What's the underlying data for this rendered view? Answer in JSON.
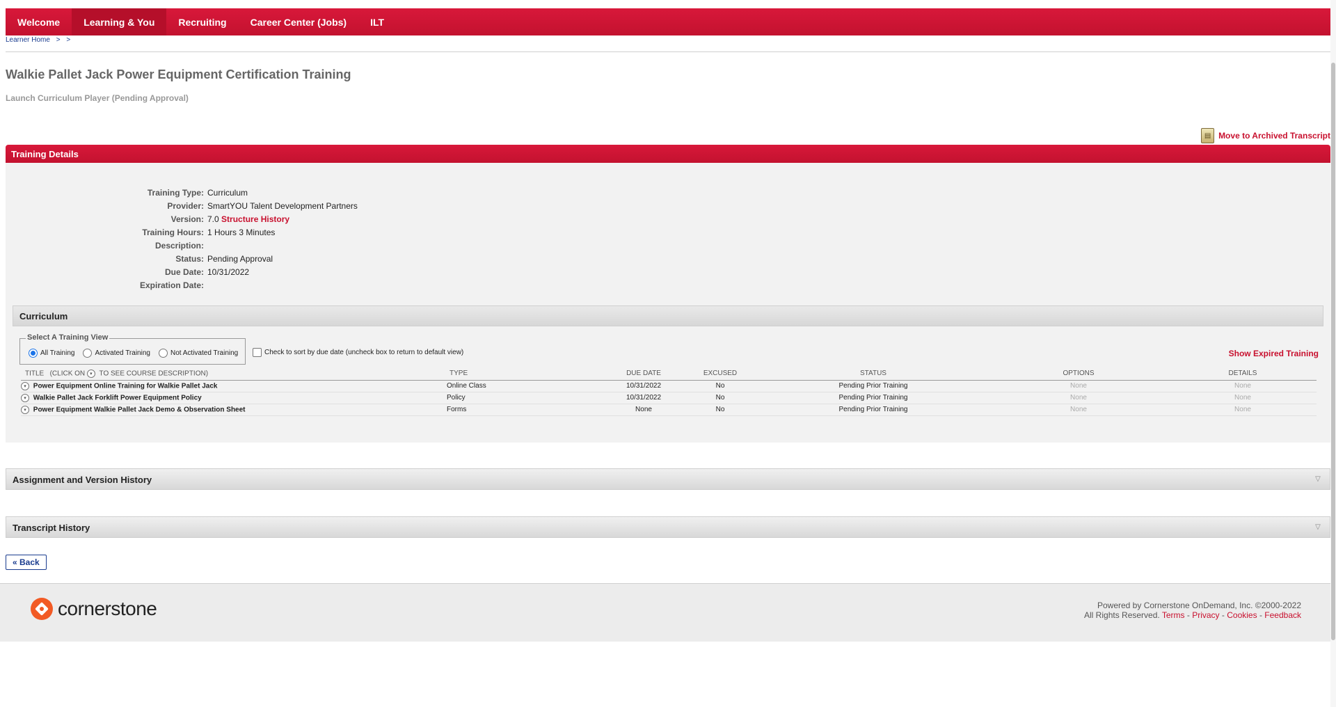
{
  "nav": {
    "tabs": [
      {
        "label": "Welcome"
      },
      {
        "label": "Learning & You"
      },
      {
        "label": "Recruiting"
      },
      {
        "label": "Career Center (Jobs)"
      },
      {
        "label": "ILT"
      }
    ],
    "active_tab": "Learning & You"
  },
  "breadcrumb": {
    "home": "Learner Home",
    "sep1": ">",
    "sep2": ">"
  },
  "page": {
    "title": "Walkie Pallet Jack Power Equipment Certification Training",
    "subtitle": "Launch Curriculum Player (Pending Approval)",
    "archive_link": "Move to Archived Transcript"
  },
  "training_details": {
    "header": "Training Details",
    "labels": {
      "type": "Training Type:",
      "provider": "Provider:",
      "version": "Version:",
      "hours": "Training Hours:",
      "description": "Description:",
      "status": "Status:",
      "due": "Due Date:",
      "expiration": "Expiration Date:"
    },
    "values": {
      "type": "Curriculum",
      "provider": "SmartYOU Talent Development Partners",
      "version": "7.0",
      "structure_history": "Structure History",
      "hours": "1 Hours 3 Minutes",
      "description": "",
      "status": "Pending Approval",
      "due": "10/31/2022",
      "expiration": ""
    }
  },
  "curriculum": {
    "header": "Curriculum",
    "view_legend": "Select A Training View",
    "views": [
      "All Training",
      "Activated Training",
      "Not Activated Training"
    ],
    "selected_view": "All Training",
    "sort_label": "Check to sort by due date (uncheck box to return to default view)",
    "show_expired": "Show Expired Training",
    "columns": {
      "title": "TITLE",
      "title_hint_prefix": "(CLICK ON",
      "title_hint_suffix": "TO SEE COURSE DESCRIPTION)",
      "type": "TYPE",
      "due": "DUE DATE",
      "excused": "EXCUSED",
      "status": "STATUS",
      "options": "OPTIONS",
      "details": "DETAILS"
    },
    "rows": [
      {
        "title": "Power Equipment Online Training for Walkie Pallet Jack",
        "type": "Online Class",
        "due": "10/31/2022",
        "excused": "No",
        "status": "Pending Prior Training",
        "options": "None",
        "details": "None"
      },
      {
        "title": "Walkie Pallet Jack Forklift Power Equipment Policy",
        "type": "Policy",
        "due": "10/31/2022",
        "excused": "No",
        "status": "Pending Prior Training",
        "options": "None",
        "details": "None"
      },
      {
        "title": "Power Equipment Walkie Pallet Jack Demo & Observation Sheet",
        "type": "Forms",
        "due": "None",
        "excused": "No",
        "status": "Pending Prior Training",
        "options": "None",
        "details": "None"
      }
    ]
  },
  "sections": {
    "assignment_history": "Assignment and Version History",
    "transcript_history": "Transcript History"
  },
  "back_button": "« Back",
  "footer": {
    "logo_text": "cornerstone",
    "powered_by": "Powered by Cornerstone OnDemand, Inc. ©2000-2022",
    "rights": "All Rights Reserved.",
    "links": [
      "Terms",
      "Privacy",
      "Cookies",
      "Feedback"
    ],
    "sep": "-"
  },
  "colors": {
    "brand_red": "#c8102e",
    "link_blue": "#1a3c8f",
    "cornerstone_orange": "#f25a24"
  }
}
